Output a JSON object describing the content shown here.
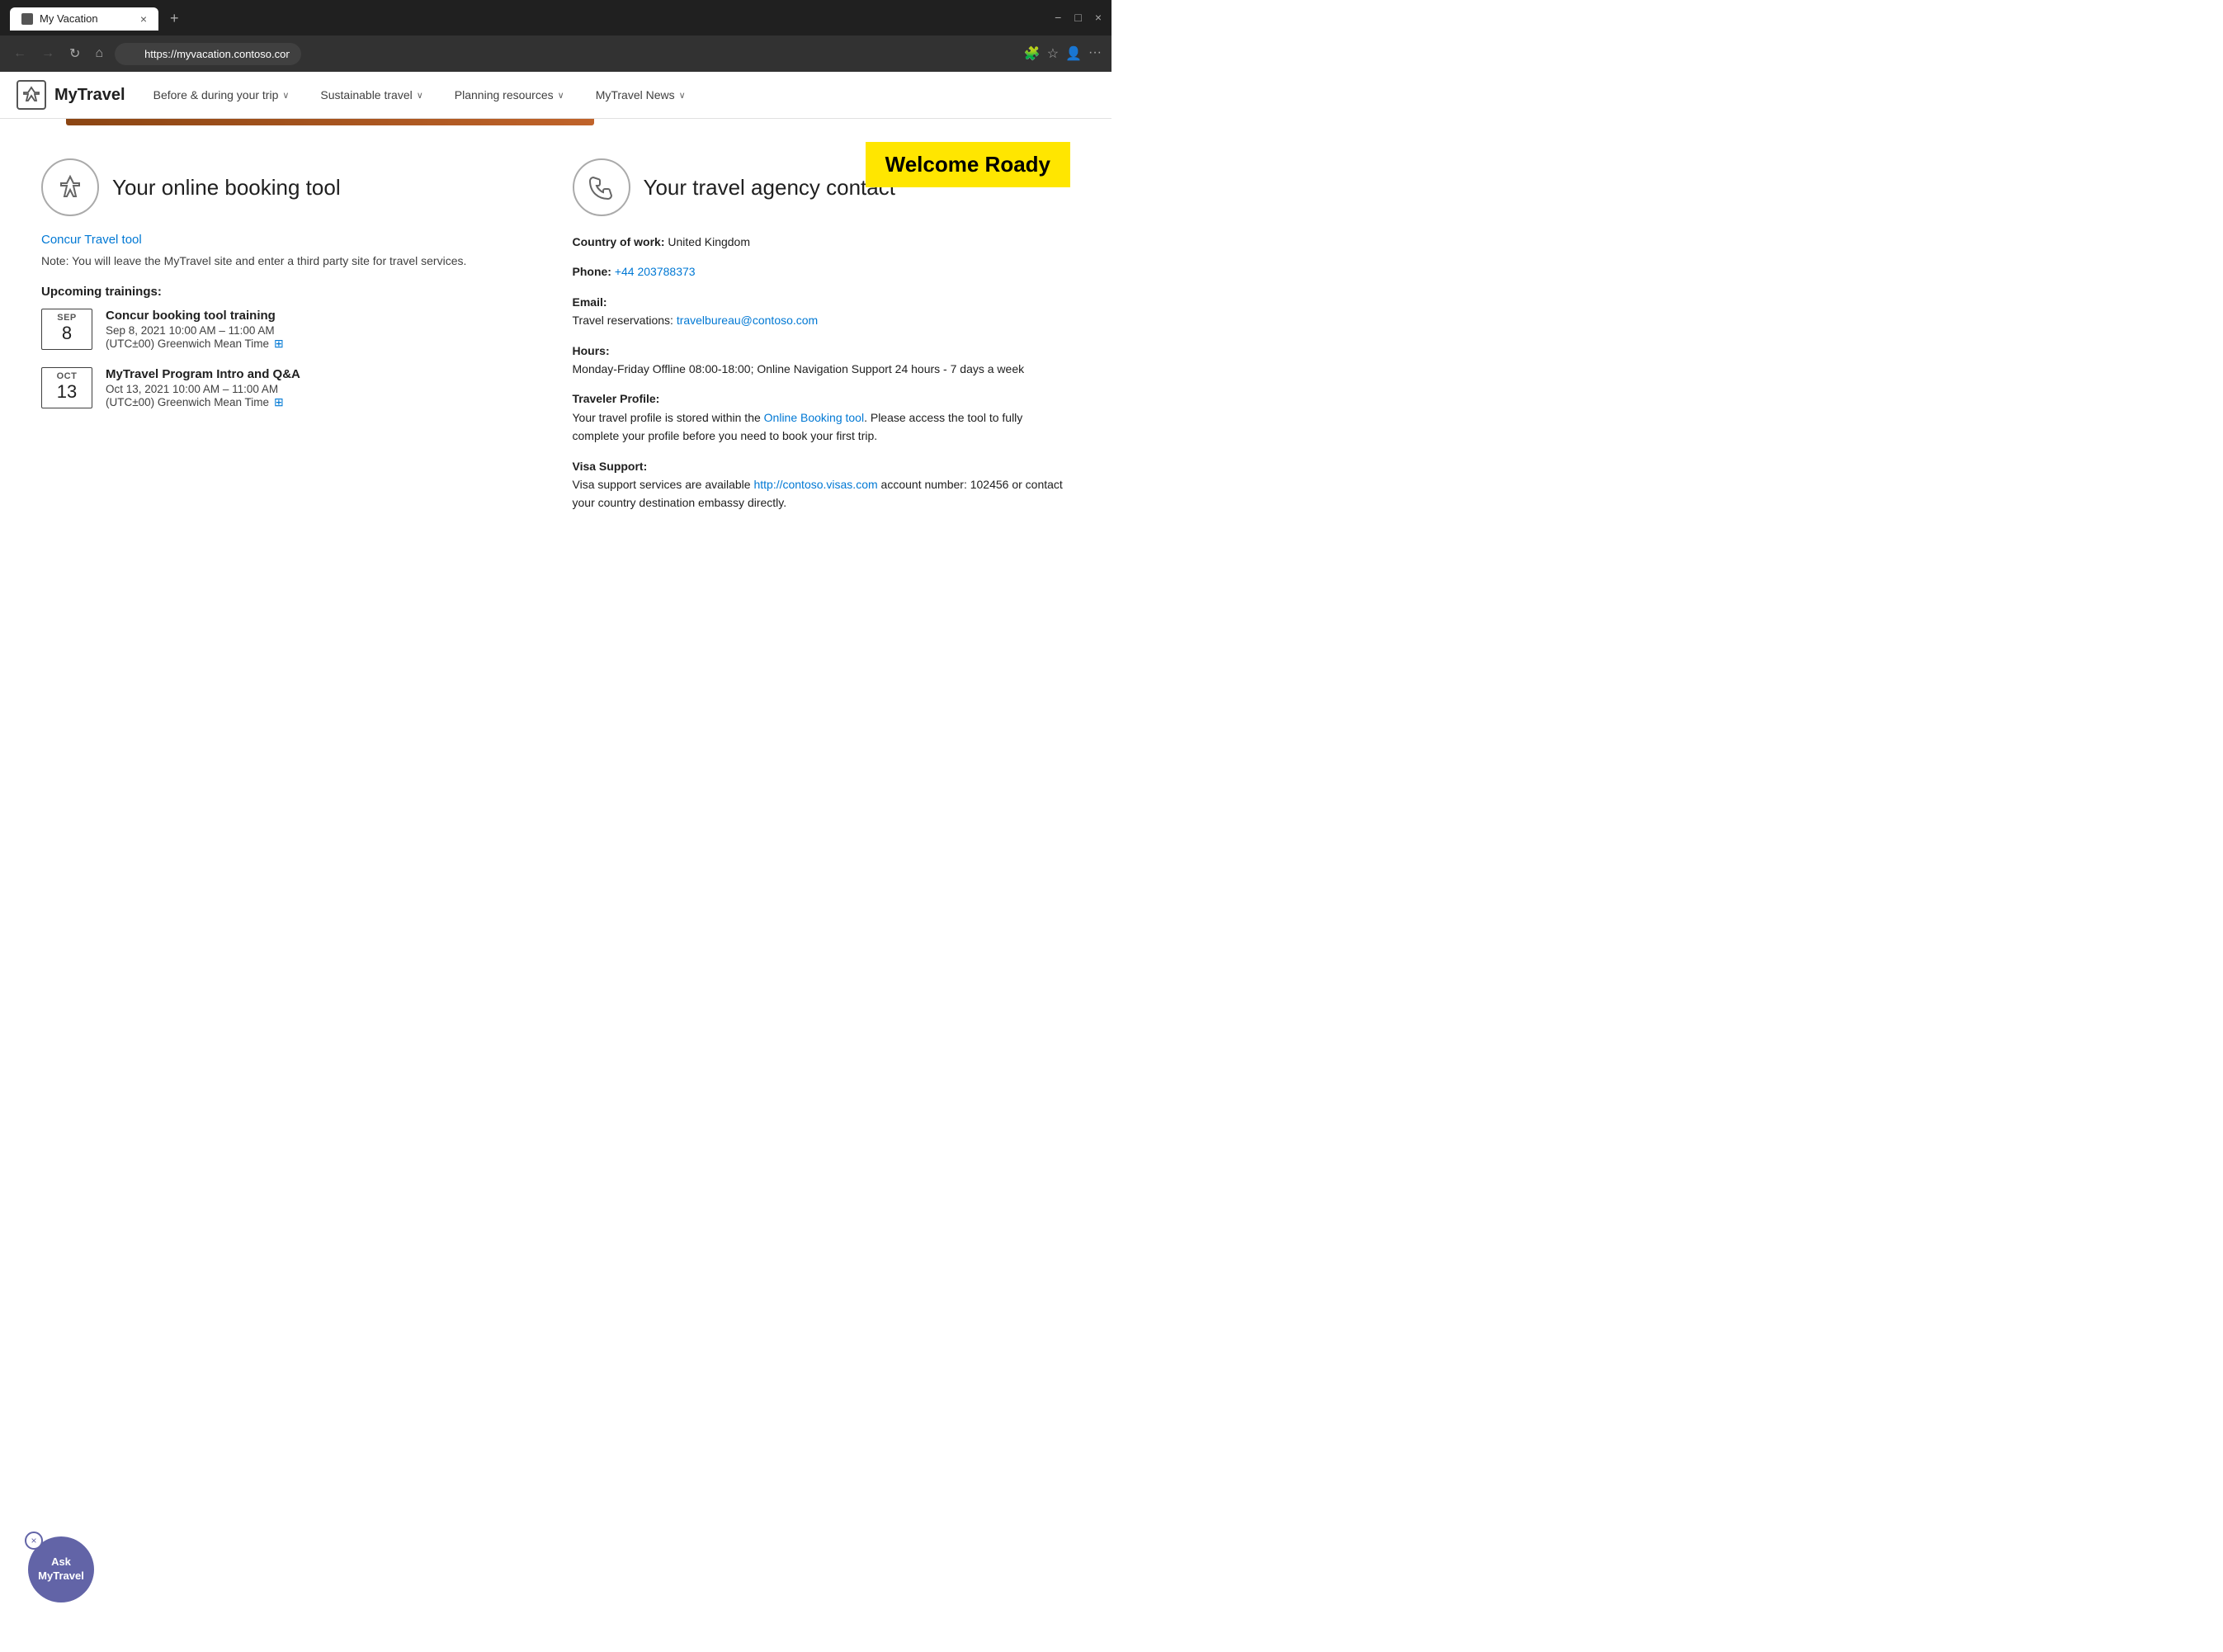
{
  "browser": {
    "tab_title": "My Vacation",
    "tab_close": "×",
    "new_tab": "+",
    "url": "https://myvacation.contoso.com/secured/default.html",
    "win_min": "−",
    "win_max": "□",
    "win_close": "×",
    "nav_back": "←",
    "nav_forward": "→",
    "nav_refresh": "↻",
    "nav_home": "⌂",
    "actions_extensions": "🧩",
    "actions_favorites": "☆",
    "actions_profiles": "👤",
    "actions_more": "···"
  },
  "site": {
    "logo_icon": "✈",
    "logo_text": "MyTravel",
    "nav_items": [
      {
        "label": "Before & during your trip",
        "chevron": "∨"
      },
      {
        "label": "Sustainable travel",
        "chevron": "∨"
      },
      {
        "label": "Planning resources",
        "chevron": "∨"
      },
      {
        "label": "MyTravel News",
        "chevron": "∨"
      }
    ]
  },
  "welcome": {
    "text": "Welcome Roady"
  },
  "booking_tool": {
    "section_icon": "✈",
    "section_title": "Your online booking tool",
    "concur_link_text": "Concur Travel tool",
    "note_text": "Note: You will leave the MyTravel site and enter a third party site for travel services.",
    "trainings_label": "Upcoming trainings:",
    "trainings": [
      {
        "month": "SEP",
        "day": "8",
        "name": "Concur booking tool training",
        "date_time": "Sep 8, 2021   10:00 AM – 11:00 AM",
        "timezone": "(UTC±00) Greenwich Mean Time",
        "cal_icon": "⊞"
      },
      {
        "month": "OCT",
        "day": "13",
        "name": "MyTravel Program Intro and Q&A",
        "date_time": "Oct 13, 2021   10:00 AM – 11:00 AM",
        "timezone": "(UTC±00) Greenwich Mean Time",
        "cal_icon": "⊞"
      }
    ]
  },
  "travel_agency": {
    "section_icon": "☎",
    "section_title": "Your travel agency contact",
    "country_label": "Country of work:",
    "country_value": "United Kingdom",
    "phone_label": "Phone:",
    "phone_value": "+44 203788373",
    "email_label": "Email:",
    "email_sub": "Travel reservations:",
    "email_value": "travelbureau@contoso.com",
    "hours_label": "Hours:",
    "hours_value": "Monday-Friday Offline 08:00-18:00; Online Navigation Support 24 hours - 7 days a week",
    "traveler_profile_label": "Traveler Profile:",
    "traveler_profile_text1": "Your travel profile is stored within the ",
    "traveler_profile_link": "Online Booking tool",
    "traveler_profile_text2": ". Please access the tool to fully complete your profile before you need to book your first trip.",
    "visa_support_label": "Visa Support:",
    "visa_support_text1": "Visa support services are available ",
    "visa_support_link": "http://contoso.visas.com",
    "visa_support_text2": " account number: 102456 or contact your country destination embassy directly."
  },
  "chat_widget": {
    "close_icon": "×",
    "button_text": "Ask\nMyTravel"
  }
}
